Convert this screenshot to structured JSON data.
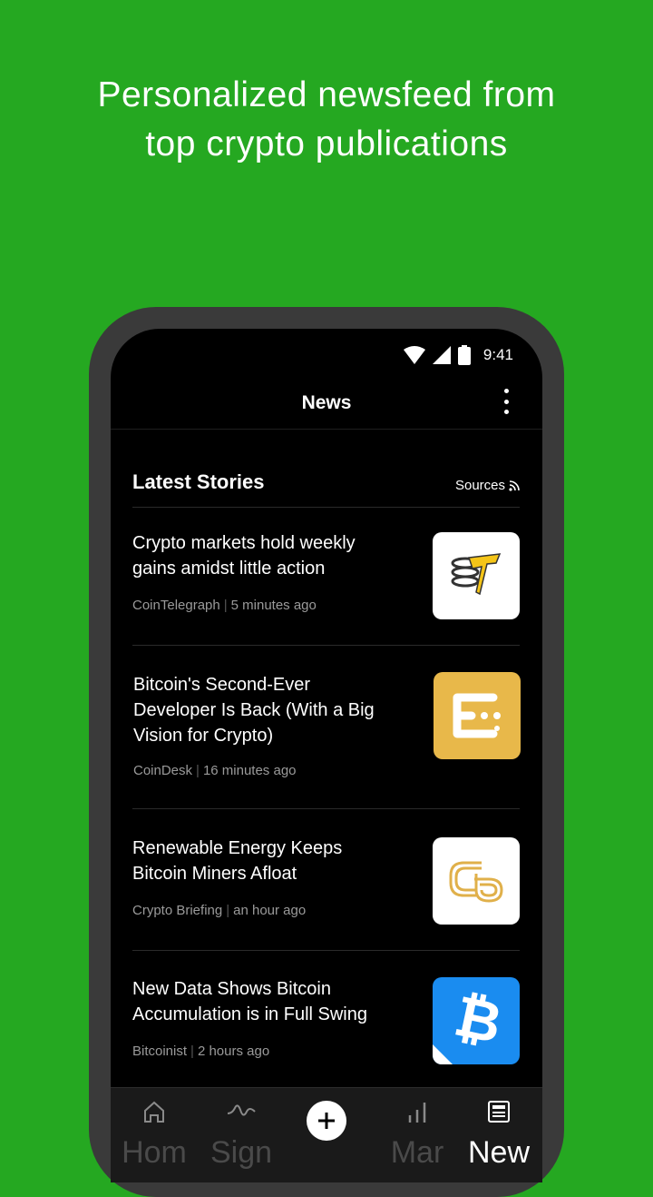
{
  "promo": {
    "line1": "Personalized newsfeed from",
    "line2": "top crypto publications"
  },
  "status_bar": {
    "time": "9:41"
  },
  "header": {
    "title": "News"
  },
  "section": {
    "title": "Latest Stories",
    "sources_label": "Sources"
  },
  "stories": [
    {
      "title": "Crypto markets hold weekly gains amidst little action",
      "source": "CoinTelegraph",
      "time": "5 minutes ago",
      "thumb": "cointelegraph-logo"
    },
    {
      "title": "Bitcoin's Second-Ever Developer Is Back (With a Big Vision for Crypto)",
      "source": "CoinDesk",
      "time": "16 minutes ago",
      "thumb": "coindesk-logo"
    },
    {
      "title": "Renewable Energy Keeps Bitcoin Miners Afloat",
      "source": "Crypto Briefing",
      "time": "an hour ago",
      "thumb": "cryptobriefing-logo"
    },
    {
      "title": "New Data Shows Bitcoin Accumulation is in Full Swing",
      "source": "Bitcoinist",
      "time": "2 hours ago",
      "thumb": "bitcoinist-logo"
    }
  ],
  "tabs": [
    {
      "label": "Hom",
      "icon": "home-icon",
      "active": false
    },
    {
      "label": "Sign",
      "icon": "signal-wave-icon",
      "active": false
    },
    {
      "label": "",
      "icon": "plus-icon",
      "active": false
    },
    {
      "label": "Mar",
      "icon": "bar-chart-icon",
      "active": false
    },
    {
      "label": "New",
      "icon": "newspaper-icon",
      "active": true
    }
  ],
  "colors": {
    "background": "#25a821",
    "phone_frame": "#3a3a3a",
    "screen": "#000000",
    "coindesk": "#e8b84a",
    "bitcoinist": "#1a8cf0"
  }
}
